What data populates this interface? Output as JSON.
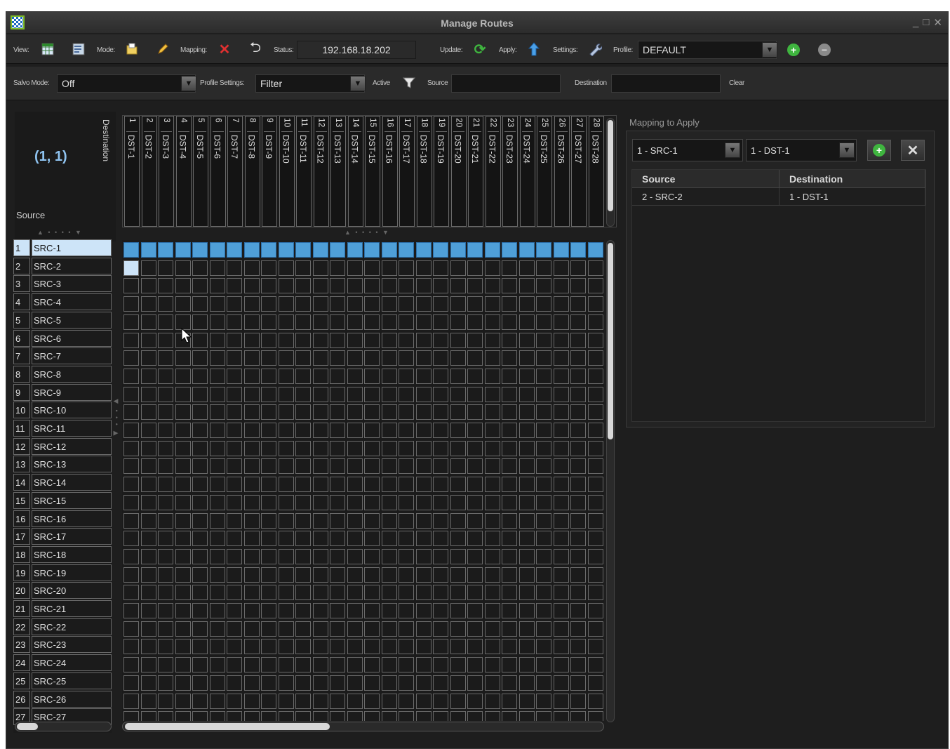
{
  "window": {
    "title": "Manage Routes",
    "controls": [
      "_",
      "□",
      "✕"
    ]
  },
  "toolbar": {
    "view_label": "View:",
    "mode_label": "Mode:",
    "mapping_label": "Mapping:",
    "status_label": "Status:",
    "status_value": "192.168.18.202",
    "update_label": "Update:",
    "apply_label": "Apply:",
    "settings_label": "Settings:",
    "profile_label": "Profile:",
    "profile_value": "DEFAULT"
  },
  "filterbar": {
    "salvo_label": "Salvo Mode:",
    "salvo_value": "Off",
    "profile_settings_label": "Profile Settings:",
    "profile_settings_value": "Filter",
    "active_label": "Active",
    "source_label": "Source",
    "source_value": "",
    "destination_label": "Destination",
    "destination_value": "",
    "clear_label": "Clear"
  },
  "matrix": {
    "coord": "(1, 1)",
    "destination_label": "Destination",
    "source_label": "Source",
    "selected_row": 1,
    "selected_cell": {
      "row": 2,
      "col": 1
    },
    "destinations": [
      {
        "num": "1",
        "name": "DST-1"
      },
      {
        "num": "2",
        "name": "DST-2"
      },
      {
        "num": "3",
        "name": "DST-3"
      },
      {
        "num": "4",
        "name": "DST-4"
      },
      {
        "num": "5",
        "name": "DST-5"
      },
      {
        "num": "6",
        "name": "DST-6"
      },
      {
        "num": "7",
        "name": "DST-7"
      },
      {
        "num": "8",
        "name": "DST-8"
      },
      {
        "num": "9",
        "name": "DST-9"
      },
      {
        "num": "10",
        "name": "DST-10"
      },
      {
        "num": "11",
        "name": "DST-11"
      },
      {
        "num": "12",
        "name": "DST-12"
      },
      {
        "num": "13",
        "name": "DST-13"
      },
      {
        "num": "14",
        "name": "DST-14"
      },
      {
        "num": "15",
        "name": "DST-15"
      },
      {
        "num": "16",
        "name": "DST-16"
      },
      {
        "num": "17",
        "name": "DST-17"
      },
      {
        "num": "18",
        "name": "DST-18"
      },
      {
        "num": "19",
        "name": "DST-19"
      },
      {
        "num": "20",
        "name": "DST-20"
      },
      {
        "num": "21",
        "name": "DST-21"
      },
      {
        "num": "22",
        "name": "DST-22"
      },
      {
        "num": "23",
        "name": "DST-23"
      },
      {
        "num": "24",
        "name": "DST-24"
      },
      {
        "num": "25",
        "name": "DST-25"
      },
      {
        "num": "26",
        "name": "DST-26"
      },
      {
        "num": "27",
        "name": "DST-27"
      },
      {
        "num": "28",
        "name": "DST-28"
      }
    ],
    "sources": [
      {
        "num": "1",
        "name": "SRC-1"
      },
      {
        "num": "2",
        "name": "SRC-2"
      },
      {
        "num": "3",
        "name": "SRC-3"
      },
      {
        "num": "4",
        "name": "SRC-4"
      },
      {
        "num": "5",
        "name": "SRC-5"
      },
      {
        "num": "6",
        "name": "SRC-6"
      },
      {
        "num": "7",
        "name": "SRC-7"
      },
      {
        "num": "8",
        "name": "SRC-8"
      },
      {
        "num": "9",
        "name": "SRC-9"
      },
      {
        "num": "10",
        "name": "SRC-10"
      },
      {
        "num": "11",
        "name": "SRC-11"
      },
      {
        "num": "12",
        "name": "SRC-12"
      },
      {
        "num": "13",
        "name": "SRC-13"
      },
      {
        "num": "14",
        "name": "SRC-14"
      },
      {
        "num": "15",
        "name": "SRC-15"
      },
      {
        "num": "16",
        "name": "SRC-16"
      },
      {
        "num": "17",
        "name": "SRC-17"
      },
      {
        "num": "18",
        "name": "SRC-18"
      },
      {
        "num": "19",
        "name": "SRC-19"
      },
      {
        "num": "20",
        "name": "SRC-20"
      },
      {
        "num": "21",
        "name": "SRC-21"
      },
      {
        "num": "22",
        "name": "SRC-22"
      },
      {
        "num": "23",
        "name": "SRC-23"
      },
      {
        "num": "24",
        "name": "SRC-24"
      },
      {
        "num": "25",
        "name": "SRC-25"
      },
      {
        "num": "26",
        "name": "SRC-26"
      },
      {
        "num": "27",
        "name": "SRC-27"
      }
    ]
  },
  "mapping_panel": {
    "title": "Mapping to Apply",
    "source_select": "1 - SRC-1",
    "destination_select": "1 - DST-1",
    "columns": [
      "Source",
      "Destination"
    ],
    "rows": [
      {
        "source": "2 - SRC-2",
        "destination": "1 - DST-1"
      }
    ]
  },
  "icons": {
    "view_grid": "grid-icon",
    "view_list": "list-icon",
    "mode_folder": "folder-icon",
    "mode_edit": "pencil-icon",
    "mapping_delete": "x-icon",
    "mapping_undo": "undo-icon",
    "update": "refresh-icon",
    "apply": "upload-arrow-icon",
    "settings": "wrench-icon",
    "filter": "funnel-icon"
  },
  "colors": {
    "highlight": "#4f9fd8",
    "selection": "#cde4f8",
    "coord_text": "#8fc3f0",
    "add_green": "#3fb53f",
    "delete_red": "#e03030"
  }
}
